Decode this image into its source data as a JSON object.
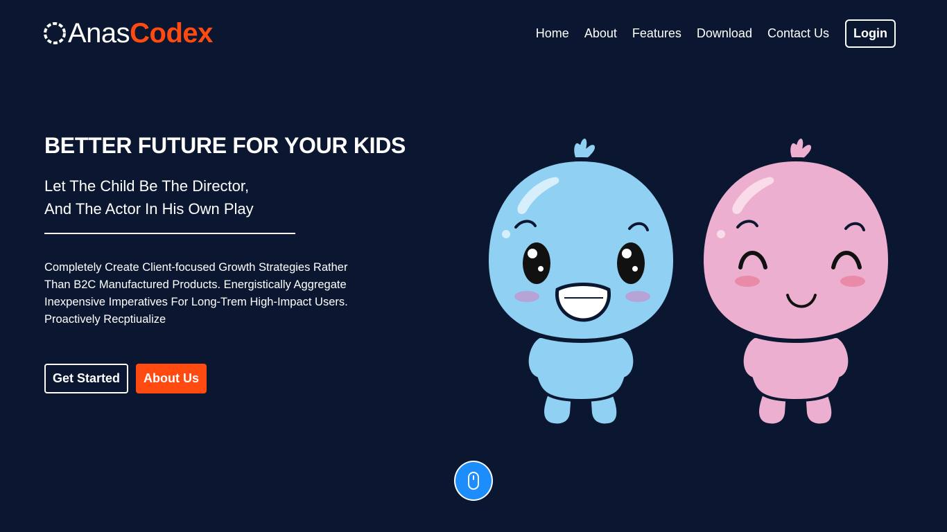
{
  "brand": {
    "name_part1": "Anas",
    "name_part2": "Codex",
    "accent_color": "#ff4a12"
  },
  "nav": {
    "items": [
      {
        "label": "Home"
      },
      {
        "label": "About"
      },
      {
        "label": "Features"
      },
      {
        "label": "Download"
      },
      {
        "label": "Contact Us"
      }
    ],
    "login_label": "Login"
  },
  "hero": {
    "title": "BETTER FUTURE FOR YOUR KIDS",
    "subtitle_line1": "Let The Child Be The Director,",
    "subtitle_line2": "And The Actor In His Own Play",
    "paragraph": "Completely Create Client-focused Growth Strategies Rather Than B2C Manufactured Products. Energistically Aggregate Inexpensive Imperatives For Long-Trem High-Impact Users. Proactively Recptiualize",
    "primary_button": "Get Started",
    "secondary_button": "About Us"
  },
  "illustration": {
    "characters": [
      "blue-cartoon-kid",
      "pink-cartoon-kid"
    ],
    "blue_color": "#8fd0f3",
    "pink_color": "#ecafcf"
  },
  "scroll_indicator": {
    "icon": "mouse-icon",
    "color": "#1c8dfb"
  },
  "colors": {
    "background": "#0b1730",
    "text": "#ffffff"
  }
}
